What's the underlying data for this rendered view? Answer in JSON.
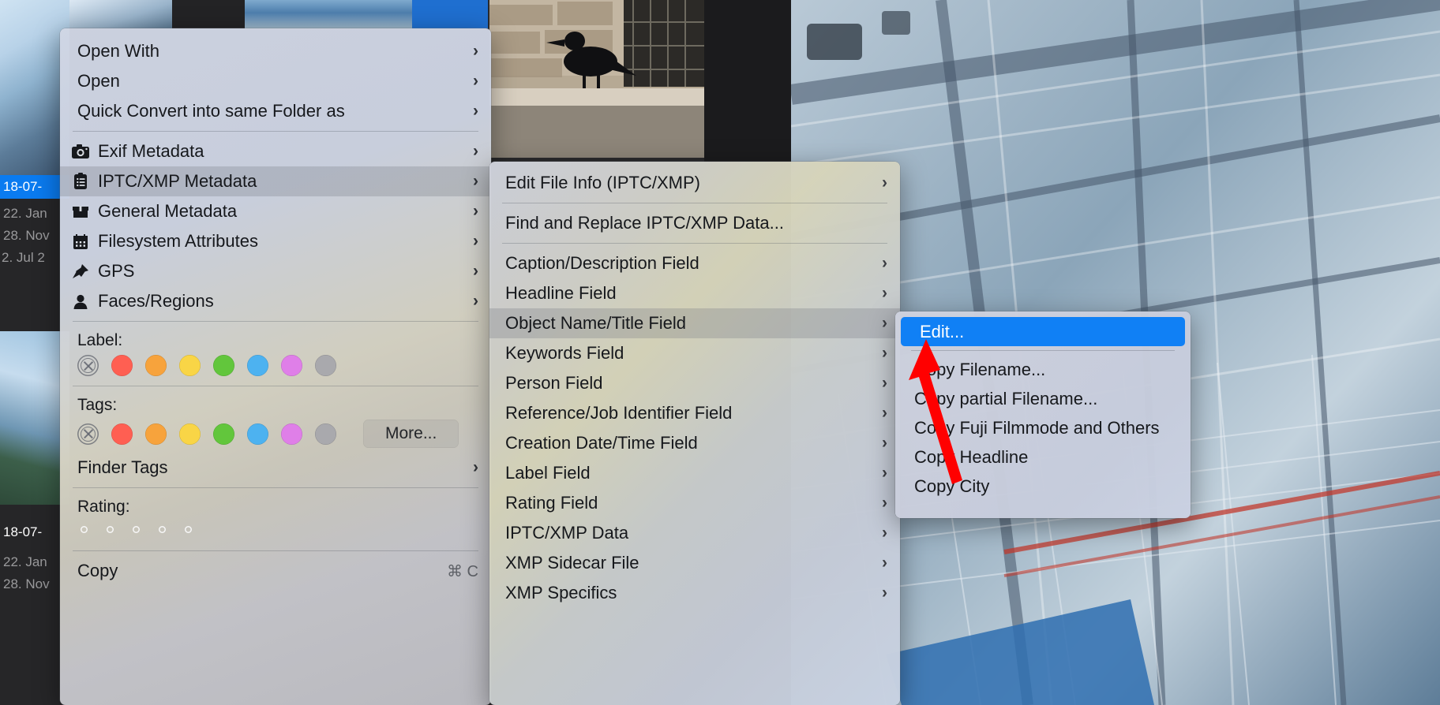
{
  "app": {
    "kind": "macos-context-menu-cascade",
    "accent_color": "#1080f5",
    "highlight_grey": "rgba(120,124,134,0.30)"
  },
  "sidebar": {
    "rows": [
      {
        "text": "18-07-",
        "selected": true
      },
      {
        "text": "22. Jan ",
        "selected": false
      },
      {
        "text": "28. Nov",
        "selected": false
      },
      {
        "text": "2. Jul 2",
        "selected": false
      }
    ],
    "rows_bottom": [
      {
        "text": "18-07-",
        "selected": true
      },
      {
        "text": "22. Jan ",
        "selected": false
      },
      {
        "text": "28. Nov",
        "selected": false
      }
    ]
  },
  "menu1": {
    "name": "root-context-menu",
    "items": [
      {
        "id": "open-with",
        "label": "Open With",
        "icon": "",
        "submenu": true
      },
      {
        "id": "open",
        "label": "Open",
        "icon": "",
        "submenu": true
      },
      {
        "id": "quick-convert",
        "label": "Quick Convert into same Folder as",
        "icon": "",
        "submenu": true
      },
      {
        "id": "separator-1",
        "separator": true
      },
      {
        "id": "exif-metadata",
        "label": "Exif Metadata",
        "icon": "camera-icon",
        "submenu": true
      },
      {
        "id": "iptc-xmp-metadata",
        "label": "IPTC/XMP Metadata",
        "icon": "clipboard-icon",
        "submenu": true,
        "highlighted": true
      },
      {
        "id": "general-metadata",
        "label": "General Metadata",
        "icon": "box-icon",
        "submenu": true
      },
      {
        "id": "filesystem-attributes",
        "label": "Filesystem Attributes",
        "icon": "calendar-icon",
        "submenu": true
      },
      {
        "id": "gps",
        "label": "GPS",
        "icon": "pushpin-icon",
        "submenu": true
      },
      {
        "id": "faces-regions",
        "label": "Faces/Regions",
        "icon": "person-icon",
        "submenu": true
      },
      {
        "id": "separator-2",
        "separator": true
      }
    ],
    "label_section": {
      "title": "Label:",
      "swatches": [
        "none",
        "#ff5f52",
        "#f7a33c",
        "#f9d546",
        "#62c council",
        "#4db2f0",
        "#df7fe8",
        "#a9a9ad"
      ]
    },
    "tags_section": {
      "title": "Tags:",
      "more_label": "More..."
    },
    "finder_tags": {
      "label": "Finder Tags",
      "submenu": true
    },
    "rating_section": {
      "title": "Rating:",
      "stars": 5,
      "filled": 0
    },
    "copy_item": {
      "label": "Copy",
      "shortcut": "⌘ C"
    },
    "swatch_colors": [
      "#ff5f52",
      "#f7a33c",
      "#f9d546",
      "#62c63c",
      "#4db2f0",
      "#df7fe8",
      "#a9a9ad"
    ]
  },
  "menu2": {
    "name": "iptc-xmp-metadata-submenu",
    "items": [
      {
        "id": "edit-file-info",
        "label": "Edit File Info (IPTC/XMP)",
        "submenu": true
      },
      {
        "id": "separator-1",
        "separator": true
      },
      {
        "id": "find-and-replace",
        "label": "Find and Replace IPTC/XMP Data...",
        "submenu": false
      },
      {
        "id": "separator-2",
        "separator": true
      },
      {
        "id": "caption-description-field",
        "label": "Caption/Description Field",
        "submenu": true
      },
      {
        "id": "headline-field",
        "label": "Headline Field",
        "submenu": true
      },
      {
        "id": "object-name-title-field",
        "label": "Object Name/Title Field",
        "submenu": true,
        "highlighted": true
      },
      {
        "id": "keywords-field",
        "label": "Keywords Field",
        "submenu": true
      },
      {
        "id": "person-field",
        "label": "Person Field",
        "submenu": true
      },
      {
        "id": "reference-job-identifier-field",
        "label": "Reference/Job Identifier Field",
        "submenu": true
      },
      {
        "id": "creation-date-time-field",
        "label": "Creation Date/Time Field",
        "submenu": true
      },
      {
        "id": "label-field",
        "label": "Label Field",
        "submenu": true
      },
      {
        "id": "rating-field",
        "label": "Rating Field",
        "submenu": true
      },
      {
        "id": "iptc-xmp-data",
        "label": "IPTC/XMP Data",
        "submenu": true
      },
      {
        "id": "xmp-sidecar-file",
        "label": "XMP Sidecar File",
        "submenu": true
      },
      {
        "id": "xmp-specifics",
        "label": "XMP Specifics",
        "submenu": true
      }
    ]
  },
  "menu3": {
    "name": "object-name-title-field-submenu",
    "items": [
      {
        "id": "edit",
        "label": "Edit...",
        "highlighted": true
      },
      {
        "id": "separator-1",
        "separator": true
      },
      {
        "id": "copy-filename",
        "label": "Copy Filename..."
      },
      {
        "id": "copy-partial-filename",
        "label": "Copy partial Filename..."
      },
      {
        "id": "copy-fuji-filmmode",
        "label": "Copy Fuji Filmmode and Others"
      },
      {
        "id": "copy-headline",
        "label": "Copy Headline"
      },
      {
        "id": "copy-city",
        "label": "Copy City"
      }
    ]
  },
  "annotation": {
    "type": "red-arrow",
    "color": "#ff0000",
    "points_to": "Edit..."
  }
}
